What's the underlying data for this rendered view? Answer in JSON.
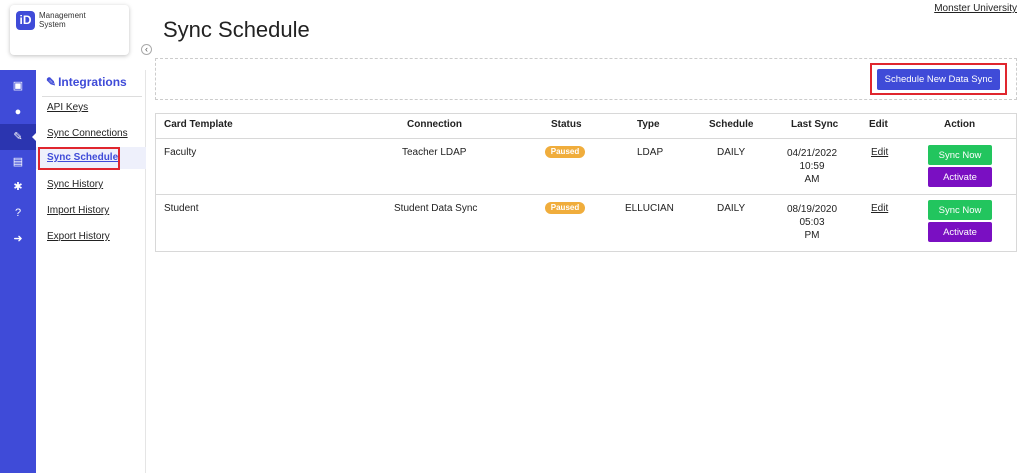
{
  "app": {
    "logo_mark": "iD",
    "logo_line1": "Management",
    "logo_line2": "System",
    "collapse_glyph": "‹"
  },
  "header": {
    "title": "Sync Schedule",
    "org": "Monster University"
  },
  "rail": [
    {
      "icon": "id-card-icon",
      "glyph": "▣"
    },
    {
      "icon": "chat-icon",
      "glyph": "●"
    },
    {
      "icon": "plug-icon",
      "glyph": "✎"
    },
    {
      "icon": "document-icon",
      "glyph": "▤"
    },
    {
      "icon": "gear-icon",
      "glyph": "✱"
    },
    {
      "icon": "help-icon",
      "glyph": "?"
    },
    {
      "icon": "logout-icon",
      "glyph": "➜"
    }
  ],
  "sidebar": {
    "section": "Integrations",
    "items": [
      {
        "label": "API Keys"
      },
      {
        "label": "Sync Connections"
      },
      {
        "label": "Sync Schedule"
      },
      {
        "label": "Sync History"
      },
      {
        "label": "Import History"
      },
      {
        "label": "Export History"
      }
    ]
  },
  "toolbar": {
    "new_label": "Schedule New Data Sync"
  },
  "table": {
    "headers": [
      "Card Template",
      "Connection",
      "Status",
      "Type",
      "Schedule",
      "Last Sync",
      "Edit",
      "Action"
    ],
    "rows": [
      {
        "template": "Faculty",
        "connection": "Teacher LDAP",
        "status": "Paused",
        "type": "LDAP",
        "schedule": "DAILY",
        "last_sync_1": "04/21/2022 10:59",
        "last_sync_2": "AM",
        "edit": "Edit",
        "sync": "Sync Now",
        "activate": "Activate"
      },
      {
        "template": "Student",
        "connection": "Student Data Sync",
        "status": "Paused",
        "type": "ELLUCIAN",
        "schedule": "DAILY",
        "last_sync_1": "08/19/2020 05:03",
        "last_sync_2": "PM",
        "edit": "Edit",
        "sync": "Sync Now",
        "activate": "Activate"
      }
    ]
  },
  "colors": {
    "brand": "#3f4bd8",
    "paused": "#f0ad3c",
    "sync": "#22c55e",
    "activate": "#7a0fc2",
    "highlight": "#e0262e"
  }
}
